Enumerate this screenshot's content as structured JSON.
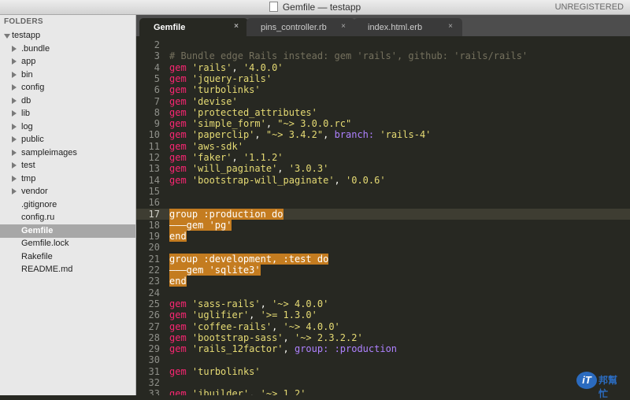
{
  "window": {
    "title": "Gemfile — testapp",
    "registration": "UNREGISTERED"
  },
  "sidebar": {
    "header": "FOLDERS",
    "items": [
      {
        "label": "testapp",
        "depth": 0,
        "type": "folder-open"
      },
      {
        "label": ".bundle",
        "depth": 1,
        "type": "folder"
      },
      {
        "label": "app",
        "depth": 1,
        "type": "folder"
      },
      {
        "label": "bin",
        "depth": 1,
        "type": "folder"
      },
      {
        "label": "config",
        "depth": 1,
        "type": "folder"
      },
      {
        "label": "db",
        "depth": 1,
        "type": "folder"
      },
      {
        "label": "lib",
        "depth": 1,
        "type": "folder"
      },
      {
        "label": "log",
        "depth": 1,
        "type": "folder"
      },
      {
        "label": "public",
        "depth": 1,
        "type": "folder"
      },
      {
        "label": "sampleimages",
        "depth": 1,
        "type": "folder"
      },
      {
        "label": "test",
        "depth": 1,
        "type": "folder"
      },
      {
        "label": "tmp",
        "depth": 1,
        "type": "folder"
      },
      {
        "label": "vendor",
        "depth": 1,
        "type": "folder"
      },
      {
        "label": ".gitignore",
        "depth": 1,
        "type": "file"
      },
      {
        "label": "config.ru",
        "depth": 1,
        "type": "file"
      },
      {
        "label": "Gemfile",
        "depth": 1,
        "type": "file",
        "selected": true
      },
      {
        "label": "Gemfile.lock",
        "depth": 1,
        "type": "file"
      },
      {
        "label": "Rakefile",
        "depth": 1,
        "type": "file"
      },
      {
        "label": "README.md",
        "depth": 1,
        "type": "file"
      }
    ]
  },
  "tabs": [
    {
      "label": "Gemfile",
      "close": "×",
      "active": true
    },
    {
      "label": "pins_controller.rb",
      "close": "×",
      "active": false
    },
    {
      "label": "index.html.erb",
      "close": "×",
      "active": false
    }
  ],
  "editor": {
    "current_line": 17,
    "colors": {
      "keyword": "#f92672",
      "string": "#e6db74",
      "symbol": "#ae81ff",
      "comment": "#75715e",
      "selection": "#c47c20",
      "background": "#272822"
    },
    "lines": [
      {
        "n": "2",
        "tokens": []
      },
      {
        "n": "3",
        "tokens": [
          {
            "t": "# Bundle edge Rails instead: gem 'rails', github: 'rails/rails'",
            "c": "cmt"
          }
        ]
      },
      {
        "n": "4",
        "tokens": [
          {
            "t": "gem",
            "c": "kw"
          },
          {
            "t": " ",
            "c": "plain"
          },
          {
            "t": "'rails'",
            "c": "str"
          },
          {
            "t": ", ",
            "c": "plain"
          },
          {
            "t": "'4.0.0'",
            "c": "str"
          }
        ]
      },
      {
        "n": "5",
        "tokens": [
          {
            "t": "gem",
            "c": "kw"
          },
          {
            "t": " ",
            "c": "plain"
          },
          {
            "t": "'jquery-rails'",
            "c": "str"
          }
        ]
      },
      {
        "n": "6",
        "tokens": [
          {
            "t": "gem",
            "c": "kw"
          },
          {
            "t": " ",
            "c": "plain"
          },
          {
            "t": "'turbolinks'",
            "c": "str"
          }
        ]
      },
      {
        "n": "7",
        "tokens": [
          {
            "t": "gem",
            "c": "kw"
          },
          {
            "t": " ",
            "c": "plain"
          },
          {
            "t": "'devise'",
            "c": "str"
          }
        ]
      },
      {
        "n": "8",
        "tokens": [
          {
            "t": "gem",
            "c": "kw"
          },
          {
            "t": " ",
            "c": "plain"
          },
          {
            "t": "'protected_attributes'",
            "c": "str"
          }
        ]
      },
      {
        "n": "9",
        "tokens": [
          {
            "t": "gem",
            "c": "kw"
          },
          {
            "t": " ",
            "c": "plain"
          },
          {
            "t": "'simple_form'",
            "c": "str"
          },
          {
            "t": ", ",
            "c": "plain"
          },
          {
            "t": "\"~> 3.0.0.rc\"",
            "c": "str"
          }
        ]
      },
      {
        "n": "10",
        "tokens": [
          {
            "t": "gem",
            "c": "kw"
          },
          {
            "t": " ",
            "c": "plain"
          },
          {
            "t": "'paperclip'",
            "c": "str"
          },
          {
            "t": ", ",
            "c": "plain"
          },
          {
            "t": "\"~> 3.4.2\"",
            "c": "str"
          },
          {
            "t": ", ",
            "c": "plain"
          },
          {
            "t": "branch:",
            "c": "sym"
          },
          {
            "t": " ",
            "c": "plain"
          },
          {
            "t": "'rails-4'",
            "c": "str"
          }
        ]
      },
      {
        "n": "11",
        "tokens": [
          {
            "t": "gem",
            "c": "kw"
          },
          {
            "t": " ",
            "c": "plain"
          },
          {
            "t": "'aws-sdk'",
            "c": "str"
          }
        ]
      },
      {
        "n": "12",
        "tokens": [
          {
            "t": "gem",
            "c": "kw"
          },
          {
            "t": " ",
            "c": "plain"
          },
          {
            "t": "'faker'",
            "c": "str"
          },
          {
            "t": ", ",
            "c": "plain"
          },
          {
            "t": "'1.1.2'",
            "c": "str"
          }
        ]
      },
      {
        "n": "13",
        "tokens": [
          {
            "t": "gem",
            "c": "kw"
          },
          {
            "t": " ",
            "c": "plain"
          },
          {
            "t": "'will_paginate'",
            "c": "str"
          },
          {
            "t": ", ",
            "c": "plain"
          },
          {
            "t": "'3.0.3'",
            "c": "str"
          }
        ]
      },
      {
        "n": "14",
        "tokens": [
          {
            "t": "gem",
            "c": "kw"
          },
          {
            "t": " ",
            "c": "plain"
          },
          {
            "t": "'bootstrap-will_paginate'",
            "c": "str"
          },
          {
            "t": ", ",
            "c": "plain"
          },
          {
            "t": "'0.0.6'",
            "c": "str"
          }
        ]
      },
      {
        "n": "15",
        "tokens": []
      },
      {
        "n": "16",
        "tokens": []
      },
      {
        "n": "17",
        "tokens": [
          {
            "t": "group :production do",
            "c": "hl"
          }
        ]
      },
      {
        "n": "18",
        "tokens": [
          {
            "t": "———gem 'pg'",
            "c": "hl"
          }
        ]
      },
      {
        "n": "19",
        "tokens": [
          {
            "t": "end",
            "c": "hl"
          }
        ]
      },
      {
        "n": "20",
        "tokens": []
      },
      {
        "n": "21",
        "tokens": [
          {
            "t": "group :development, :test do",
            "c": "hl"
          }
        ]
      },
      {
        "n": "22",
        "tokens": [
          {
            "t": "———gem 'sqlite3'",
            "c": "hl"
          }
        ]
      },
      {
        "n": "23",
        "tokens": [
          {
            "t": "end",
            "c": "hl"
          }
        ]
      },
      {
        "n": "24",
        "tokens": []
      },
      {
        "n": "25",
        "tokens": [
          {
            "t": "gem",
            "c": "kw"
          },
          {
            "t": " ",
            "c": "plain"
          },
          {
            "t": "'sass-rails'",
            "c": "str"
          },
          {
            "t": ", ",
            "c": "plain"
          },
          {
            "t": "'~> 4.0.0'",
            "c": "str"
          }
        ]
      },
      {
        "n": "26",
        "tokens": [
          {
            "t": "gem",
            "c": "kw"
          },
          {
            "t": " ",
            "c": "plain"
          },
          {
            "t": "'uglifier'",
            "c": "str"
          },
          {
            "t": ", ",
            "c": "plain"
          },
          {
            "t": "'>= 1.3.0'",
            "c": "str"
          }
        ]
      },
      {
        "n": "27",
        "tokens": [
          {
            "t": "gem",
            "c": "kw"
          },
          {
            "t": " ",
            "c": "plain"
          },
          {
            "t": "'coffee-rails'",
            "c": "str"
          },
          {
            "t": ", ",
            "c": "plain"
          },
          {
            "t": "'~> 4.0.0'",
            "c": "str"
          }
        ]
      },
      {
        "n": "28",
        "tokens": [
          {
            "t": "gem",
            "c": "kw"
          },
          {
            "t": " ",
            "c": "plain"
          },
          {
            "t": "'bootstrap-sass'",
            "c": "str"
          },
          {
            "t": ", ",
            "c": "plain"
          },
          {
            "t": "'~> 2.3.2.2'",
            "c": "str"
          }
        ]
      },
      {
        "n": "29",
        "tokens": [
          {
            "t": "gem",
            "c": "kw"
          },
          {
            "t": " ",
            "c": "plain"
          },
          {
            "t": "'rails_12factor'",
            "c": "str"
          },
          {
            "t": ", ",
            "c": "plain"
          },
          {
            "t": "group:",
            "c": "sym"
          },
          {
            "t": " ",
            "c": "plain"
          },
          {
            "t": ":production",
            "c": "sym"
          }
        ]
      },
      {
        "n": "30",
        "tokens": []
      },
      {
        "n": "31",
        "tokens": [
          {
            "t": "gem",
            "c": "kw"
          },
          {
            "t": " ",
            "c": "plain"
          },
          {
            "t": "'turbolinks'",
            "c": "str"
          }
        ]
      },
      {
        "n": "32",
        "tokens": []
      },
      {
        "n": "33",
        "tokens": [
          {
            "t": "gem",
            "c": "kw"
          },
          {
            "t": " ",
            "c": "plain"
          },
          {
            "t": "'jbuilder'",
            "c": "str"
          },
          {
            "t": ", ",
            "c": "plain"
          },
          {
            "t": "'~> 1.2'",
            "c": "str"
          }
        ]
      }
    ]
  },
  "watermark": {
    "badge": "iT",
    "text": "邦幫忙"
  }
}
